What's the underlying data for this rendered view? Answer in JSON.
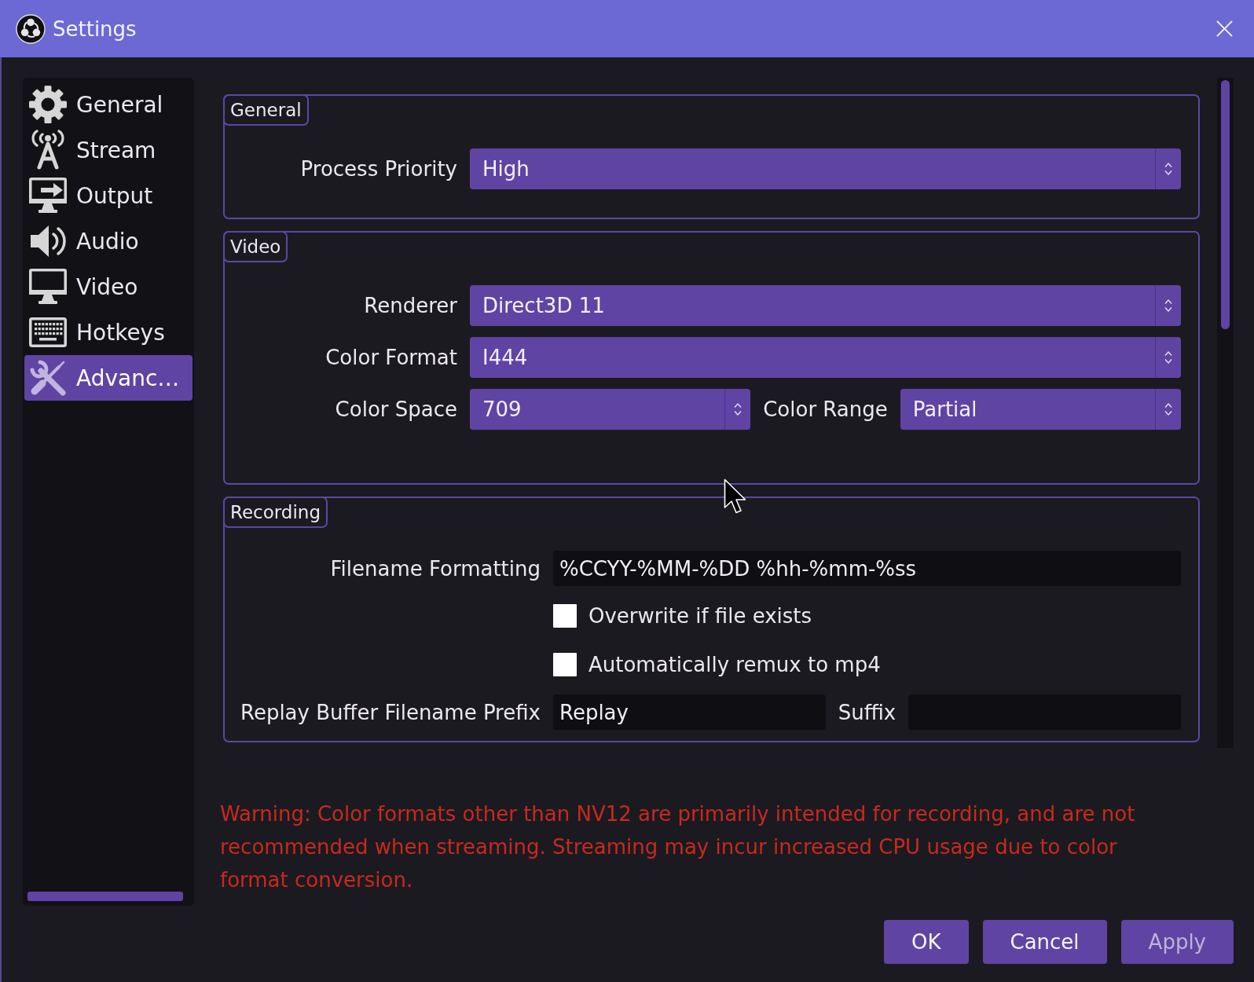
{
  "window": {
    "title": "Settings"
  },
  "sidebar": {
    "items": [
      {
        "label": "General",
        "selected": false
      },
      {
        "label": "Stream",
        "selected": false
      },
      {
        "label": "Output",
        "selected": false
      },
      {
        "label": "Audio",
        "selected": false
      },
      {
        "label": "Video",
        "selected": false
      },
      {
        "label": "Hotkeys",
        "selected": false
      },
      {
        "label": "Advanc…",
        "selected": true
      }
    ]
  },
  "groups": [
    {
      "title": "General",
      "rows": [
        {
          "kind": "combo",
          "fields": [
            {
              "label": "Process Priority",
              "value": "High"
            }
          ]
        }
      ]
    },
    {
      "title": "Video",
      "rows": [
        {
          "kind": "combo",
          "fields": [
            {
              "label": "Renderer",
              "value": "Direct3D 11"
            }
          ]
        },
        {
          "kind": "combo",
          "fields": [
            {
              "label": "Color Format",
              "value": "I444"
            }
          ]
        },
        {
          "kind": "combo",
          "fields": [
            {
              "label": "Color Space",
              "value": "709"
            },
            {
              "label": "Color Range",
              "value": "Partial"
            }
          ]
        }
      ]
    },
    {
      "title": "Recording",
      "rows": [
        {
          "kind": "text",
          "fields": [
            {
              "label": "Filename Formatting",
              "value": "%CCYY-%MM-%DD %hh-%mm-%ss"
            }
          ]
        },
        {
          "kind": "checkbox",
          "label": "Overwrite if file exists",
          "checked": false
        },
        {
          "kind": "checkbox",
          "label": "Automatically remux to mp4",
          "checked": false
        },
        {
          "kind": "text",
          "fields": [
            {
              "label": "Replay Buffer Filename Prefix",
              "value": "Replay"
            },
            {
              "label": "Suffix"
            }
          ]
        }
      ]
    }
  ],
  "warning": "Warning: Color formats other than NV12 are primarily intended for recording, and are not recommended when streaming. Streaming may incur increased CPU usage due to color format conversion.",
  "buttons": [
    {
      "label": "OK",
      "disabled": false
    },
    {
      "label": "Cancel",
      "disabled": false
    },
    {
      "label": "Apply",
      "disabled": true
    }
  ]
}
